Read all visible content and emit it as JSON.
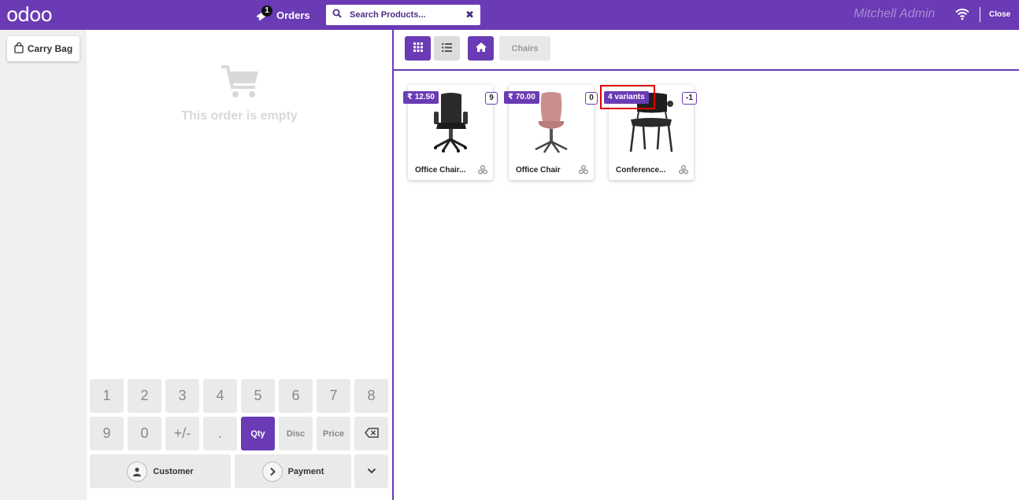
{
  "header": {
    "logo": "odoo",
    "orders_label": "Orders",
    "orders_count": "1",
    "search_placeholder": "Search Products...",
    "user_name": "Mitchell Admin",
    "close_label": "Close"
  },
  "sidebar": {
    "carry_bag_label": "Carry Bag"
  },
  "order": {
    "empty_text": "This order is empty"
  },
  "numpad": {
    "row1": [
      "1",
      "2",
      "3",
      "4",
      "5",
      "6",
      "7",
      "8"
    ],
    "row2": [
      "9",
      "0",
      "+/-",
      "."
    ],
    "modes": [
      "Qty",
      "Disc",
      "Price"
    ],
    "active_mode": "Qty",
    "customer_label": "Customer",
    "payment_label": "Payment"
  },
  "products_toolbar": {
    "breadcrumb": "Chairs"
  },
  "products": [
    {
      "name": "Office Chair...",
      "price": "₹ 12.50",
      "qty": "9"
    },
    {
      "name": "Office Chair",
      "price": "₹ 70.00",
      "qty": "0"
    },
    {
      "name": "Conference...",
      "price": "4 variants",
      "qty": "-1"
    }
  ],
  "colors": {
    "brand": "#6a3bb5",
    "highlight": "#e00000"
  }
}
